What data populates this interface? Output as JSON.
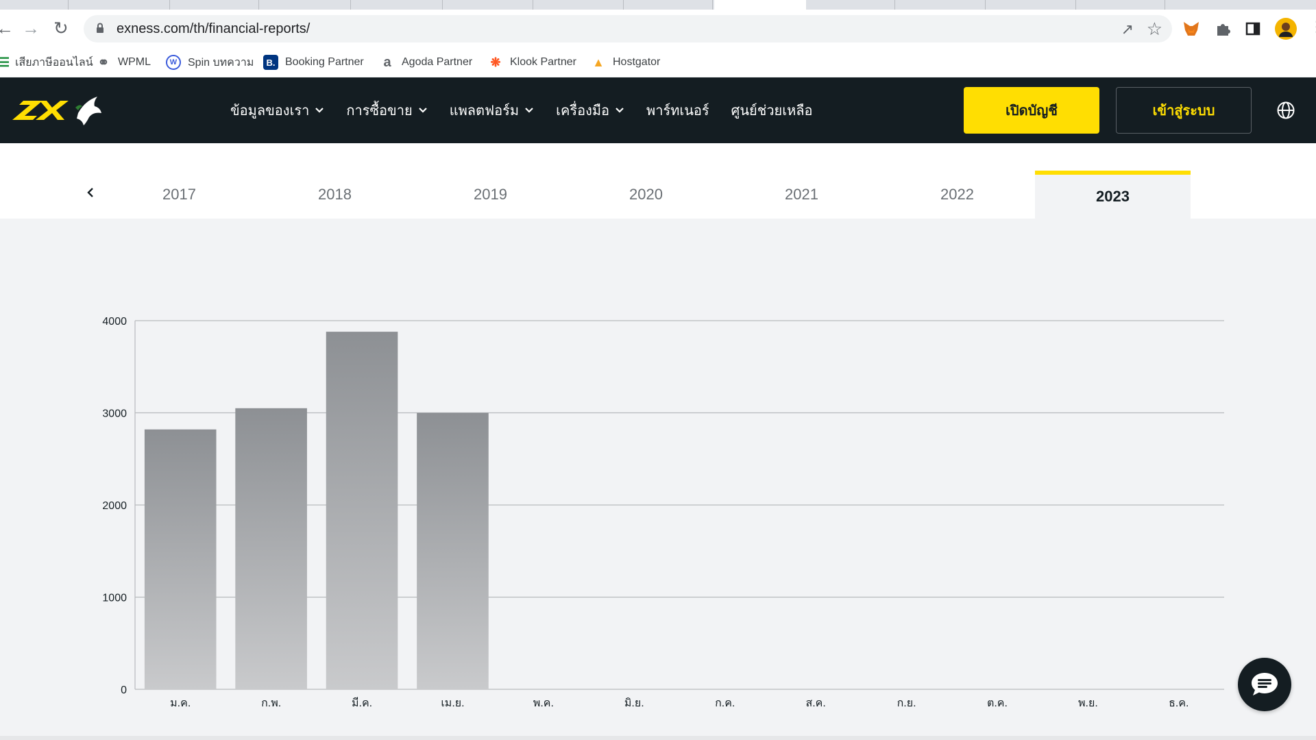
{
  "browser": {
    "url": "exness.com/th/financial-reports/",
    "bookmarks": [
      {
        "label": "เสียภาษีออนไลน์",
        "icon": "list-icon",
        "color": "#1e8e3e"
      },
      {
        "label": "WPML",
        "icon": "wpml-icon",
        "color": "#5f6368"
      },
      {
        "label": "Spin บทความ",
        "icon": "spin-icon",
        "color": "#3b5bdb"
      },
      {
        "label": "Booking Partner",
        "icon": "booking-icon",
        "color": "#003580"
      },
      {
        "label": "Agoda Partner",
        "icon": "agoda-icon",
        "color": "#5f6368"
      },
      {
        "label": "Klook Partner",
        "icon": "klook-icon",
        "color": "#ff5722"
      },
      {
        "label": "Hostgator",
        "icon": "hostgator-icon",
        "color": "#f5a623"
      }
    ]
  },
  "header": {
    "nav": [
      {
        "label": "ข้อมูลของเรา",
        "has_dropdown": true
      },
      {
        "label": "การซื้อขาย",
        "has_dropdown": true
      },
      {
        "label": "แพลตฟอร์ม",
        "has_dropdown": true
      },
      {
        "label": "เครื่องมือ",
        "has_dropdown": true
      },
      {
        "label": "พาร์ทเนอร์",
        "has_dropdown": false
      },
      {
        "label": "ศูนย์ช่วยเหลือ",
        "has_dropdown": false
      }
    ],
    "open_account_label": "เปิดบัญชี",
    "login_label": "เข้าสู่ระบบ",
    "accent_color": "#ffde02",
    "bg_color": "#141d22"
  },
  "year_tabs": {
    "years": [
      "2017",
      "2018",
      "2019",
      "2020",
      "2021",
      "2022",
      "2023"
    ],
    "active": "2023"
  },
  "chart_data": {
    "type": "bar",
    "categories": [
      "ม.ค.",
      "ก.พ.",
      "มี.ค.",
      "เม.ย.",
      "พ.ค.",
      "มิ.ย.",
      "ก.ค.",
      "ส.ค.",
      "ก.ย.",
      "ต.ค.",
      "พ.ย.",
      "ธ.ค."
    ],
    "values": [
      2820,
      3050,
      3880,
      3000,
      null,
      null,
      null,
      null,
      null,
      null,
      null,
      null
    ],
    "yticks": [
      "0",
      "1000",
      "2000",
      "3000",
      "4000"
    ],
    "ylim": [
      0,
      4000
    ],
    "grid": true,
    "bar_color_top": "#8d9094",
    "bar_color_bottom": "#c9cacc"
  }
}
